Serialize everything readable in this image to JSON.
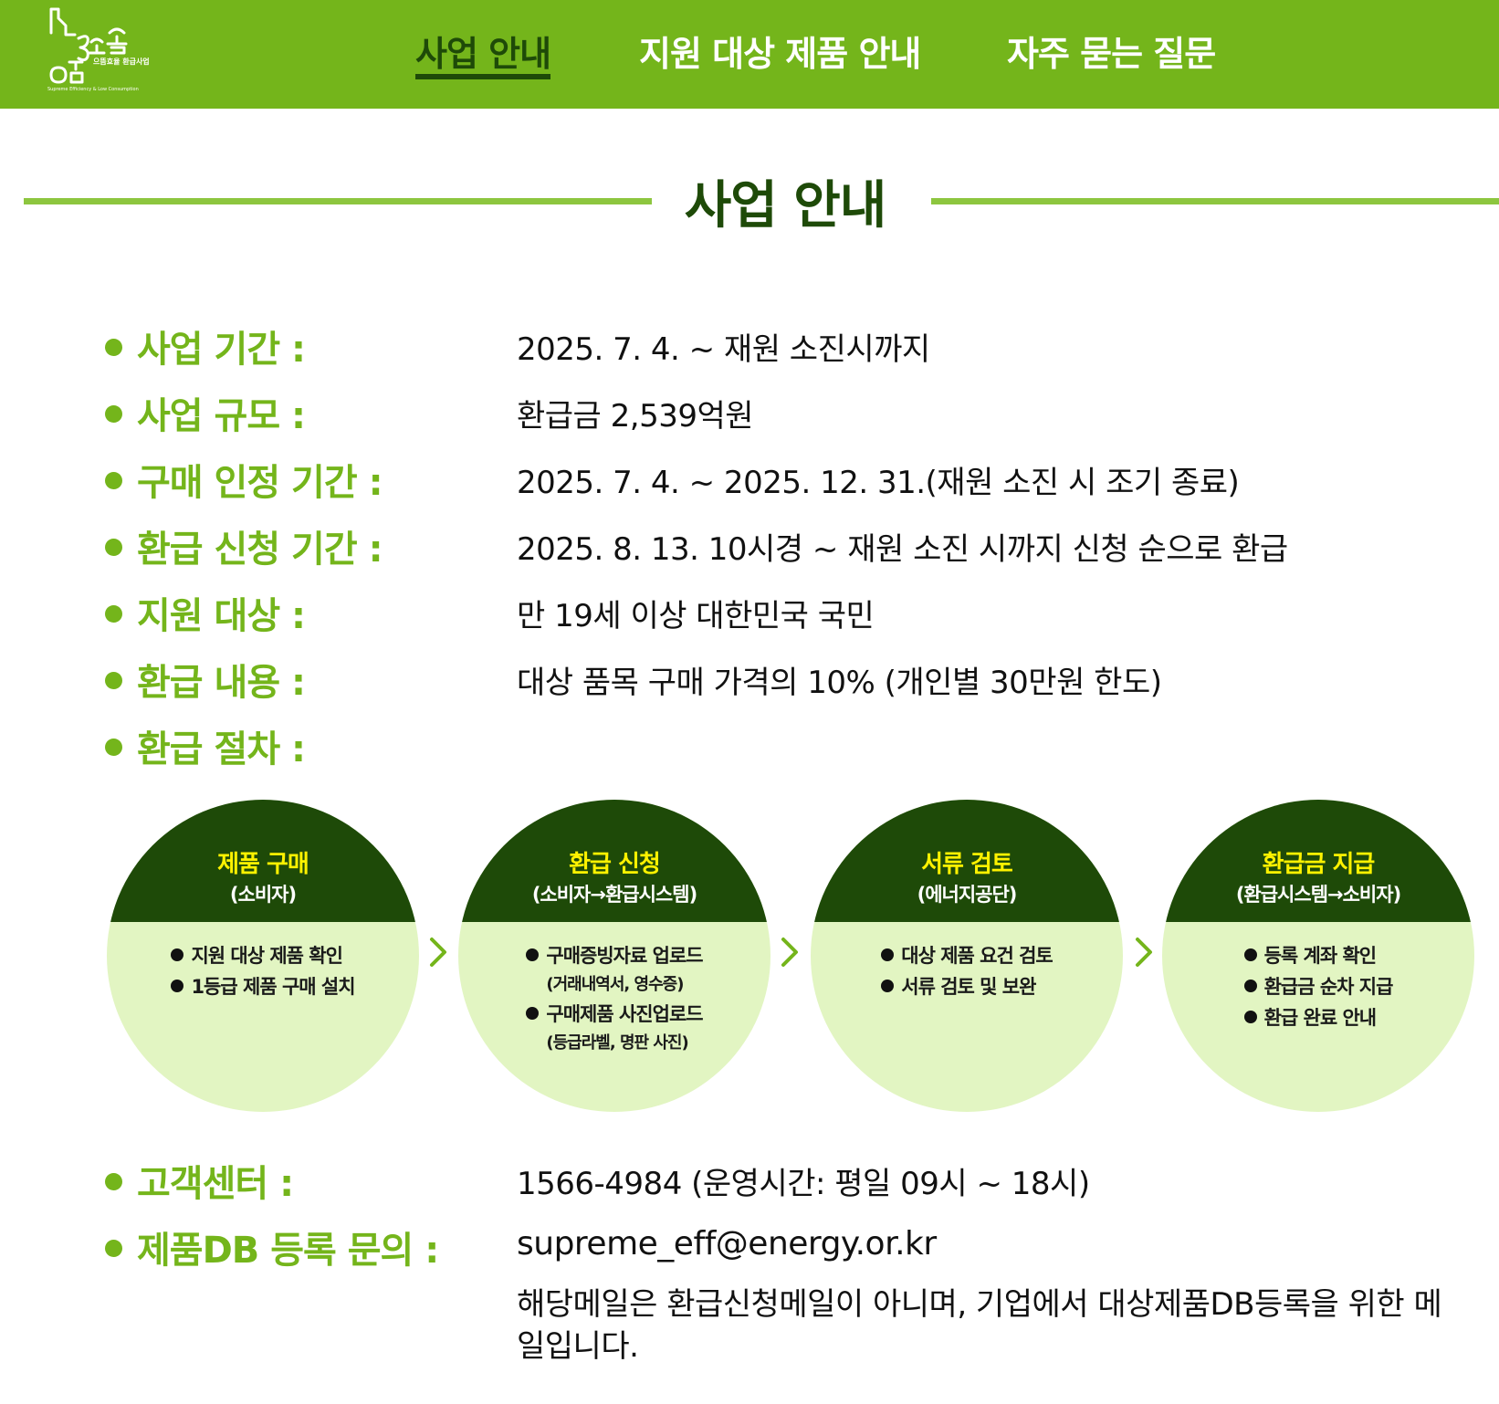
{
  "header": {
    "logo": {
      "brand_text": "으뜸효율 환급사업",
      "tagline": "Supreme Efficiency & Low Consumption"
    },
    "nav": [
      {
        "label": "사업 안내",
        "active": true
      },
      {
        "label": "지원 대상 제품 안내",
        "active": false
      },
      {
        "label": "자주 묻는 질문",
        "active": false
      }
    ]
  },
  "section": {
    "title": "사업 안내"
  },
  "info": [
    {
      "label": "사업 기간 :",
      "value": "2025. 7. 4. ~ 재원 소진시까지"
    },
    {
      "label": "사업 규모 :",
      "value": "환급금 2,539억원"
    },
    {
      "label": "구매 인정 기간 :",
      "value": "2025. 7. 4. ~ 2025. 12. 31.(재원 소진 시 조기 종료)"
    },
    {
      "label": "환급 신청 기간 :",
      "value": "2025. 8. 13. 10시경 ~ 재원 소진 시까지 신청 순으로 환급"
    },
    {
      "label": "지원 대상 :",
      "value": "만 19세 이상 대한민국 국민"
    },
    {
      "label": "환급 내용 :",
      "value": "대상 품목 구매 가격의 10% (개인별 30만원 한도)"
    },
    {
      "label": "환급 절차 :",
      "value": ""
    }
  ],
  "process": [
    {
      "title": "제품 구매",
      "subtitle": "(소비자)",
      "items": [
        {
          "text": "지원 대상 제품 확인",
          "note": ""
        },
        {
          "text": "1등급 제품 구매 설치",
          "note": ""
        }
      ]
    },
    {
      "title": "환급 신청",
      "subtitle": "(소비자→환급시스템)",
      "items": [
        {
          "text": "구매증빙자료 업로드",
          "note": "(거래내역서, 영수증)"
        },
        {
          "text": "구매제품 사진업로드",
          "note": "(등급라벨, 명판 사진)"
        }
      ]
    },
    {
      "title": "서류 검토",
      "subtitle": "(에너지공단)",
      "items": [
        {
          "text": "대상 제품 요건 검토",
          "note": ""
        },
        {
          "text": "서류 검토 및 보완",
          "note": ""
        }
      ]
    },
    {
      "title": "환급금 지급",
      "subtitle": "(환급시스템→소비자)",
      "items": [
        {
          "text": "등록 계좌 확인",
          "note": ""
        },
        {
          "text": "환급금 순차 지급",
          "note": ""
        },
        {
          "text": "환급 완료 안내",
          "note": ""
        }
      ]
    }
  ],
  "contact": [
    {
      "label": "고객센터 :",
      "value": "1566-4984  (운영시간: 평일 09시 ~ 18시)"
    },
    {
      "label": "제품DB 등록 문의 :",
      "value": "supreme_eff@energy.or.kr"
    }
  ],
  "email_note": "해당메일은 환급신청메일이 아니며, 기업에서 대상제품DB등록을 위한 메일입니다.",
  "colors": {
    "header_bg": "#74b51b",
    "nav_active": "#1e4a08",
    "label_green": "#74b51b",
    "circle_top": "#1e4a08",
    "circle_bottom": "#e2f5c2",
    "circle_title": "#fff200"
  },
  "icons": {
    "bullet": "filled-circle",
    "step_arrow": "chevron-right-icon"
  }
}
